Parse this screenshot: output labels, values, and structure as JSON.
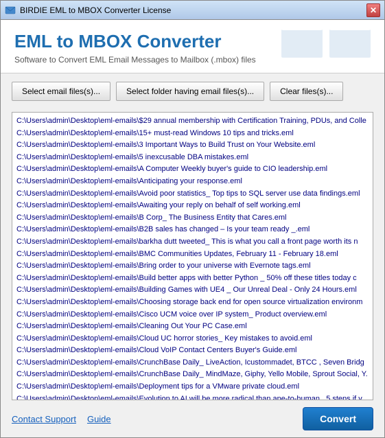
{
  "window": {
    "title": "BIRDIE EML to MBOX Converter License",
    "close_label": "✕"
  },
  "header": {
    "title": "EML to MBOX Converter",
    "subtitle": "Software to Convert EML Email Messages to Mailbox (.mbox) files"
  },
  "buttons": {
    "select_files": "Select email files(s)...",
    "select_folder": "Select folder having email files(s)...",
    "clear_files": "Clear files(s)...",
    "convert": "Convert"
  },
  "footer": {
    "contact_support": "Contact Support",
    "guide": "Guide"
  },
  "files": [
    "C:\\Users\\admin\\Desktop\\eml-emails\\$29 annual membership with Certification Training, PDUs, and Colle",
    "C:\\Users\\admin\\Desktop\\eml-emails\\15+ must-read Windows 10 tips and tricks.eml",
    "C:\\Users\\admin\\Desktop\\eml-emails\\3 Important Ways to Build Trust on Your Website.eml",
    "C:\\Users\\admin\\Desktop\\eml-emails\\5 inexcusable DBA mistakes.eml",
    "C:\\Users\\admin\\Desktop\\eml-emails\\A Computer Weekly buyer's guide to CIO leadership.eml",
    "C:\\Users\\admin\\Desktop\\eml-emails\\Anticipating your response.eml",
    "C:\\Users\\admin\\Desktop\\eml-emails\\Avoid poor statistics_ Top tips to SQL server use data findings.eml",
    "C:\\Users\\admin\\Desktop\\eml-emails\\Awaiting your reply on behalf of self working.eml",
    "C:\\Users\\admin\\Desktop\\eml-emails\\B Corp_ The Business Entity that Cares.eml",
    "C:\\Users\\admin\\Desktop\\eml-emails\\B2B sales has changed – Is your team ready _.eml",
    "C:\\Users\\admin\\Desktop\\eml-emails\\barkha dutt tweeted_ This is what you call a front page worth its n",
    "C:\\Users\\admin\\Desktop\\eml-emails\\BMC Communities Updates, February 11 - February 18.eml",
    "C:\\Users\\admin\\Desktop\\eml-emails\\Bring order to your universe with Evernote tags.eml",
    "C:\\Users\\admin\\Desktop\\eml-emails\\Build better apps with better Python _ 50% off these titles today c",
    "C:\\Users\\admin\\Desktop\\eml-emails\\Building Games with UE4 _ Our Unreal Deal - Only 24 Hours.eml",
    "C:\\Users\\admin\\Desktop\\eml-emails\\Choosing storage back end for open source virtualization environm",
    "C:\\Users\\admin\\Desktop\\eml-emails\\Cisco UCM voice over IP system_ Product overview.eml",
    "C:\\Users\\admin\\Desktop\\eml-emails\\Cleaning Out Your PC Case.eml",
    "C:\\Users\\admin\\Desktop\\eml-emails\\Cloud UC horror stories_ Key mistakes to avoid.eml",
    "C:\\Users\\admin\\Desktop\\eml-emails\\Cloud VoIP Contact Centers Buyer's Guide.eml",
    "C:\\Users\\admin\\Desktop\\eml-emails\\CrunchBase Daily_ LiveAction, Icustommadet, BTCC , Seven Bridg",
    "C:\\Users\\admin\\Desktop\\eml-emails\\CrunchBase Daily_ MindMaze, Giphy, Yello Mobile, Sprout Social, Y.",
    "C:\\Users\\admin\\Desktop\\eml-emails\\Deployment tips for a VMware private cloud.eml",
    "C:\\Users\\admin\\Desktop\\eml-emails\\Evolution to AI will be more radical than ape-to-human_ 5 steps if v"
  ]
}
